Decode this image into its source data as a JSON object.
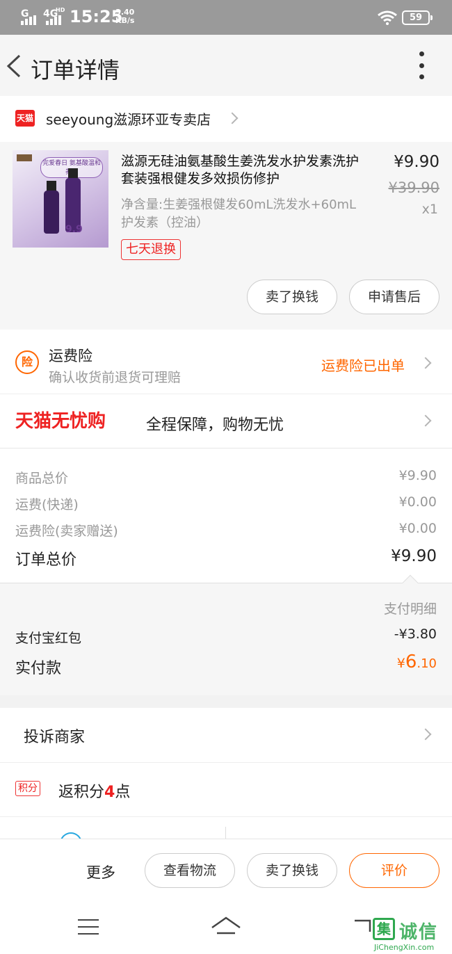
{
  "status_bar": {
    "network1": "G",
    "network2": "4G",
    "network2_sup": "HD",
    "time": "15:25",
    "speed_value": "3.40",
    "speed_unit": "KB/s",
    "battery": "59"
  },
  "header": {
    "title": "订单详情"
  },
  "shop": {
    "badge": "天猫",
    "name": "seeyoung滋源环亚专卖店"
  },
  "product": {
    "image_banner": "完爱春日 氨基酸温和养护",
    "image_promo": "9.9",
    "title": "滋源无硅油氨基酸生姜洗发水护发素洗护套装强根健发多效损伤修护",
    "price": "¥9.90",
    "original_price": "¥39.90",
    "quantity": "x1",
    "spec": "净含量:生姜强根健发60mL洗发水+60mL护发素（控油）",
    "tag": "七天退换",
    "sell_button": "卖了换钱",
    "aftersale_button": "申请售后"
  },
  "shipping_insurance": {
    "icon_text": "险",
    "title": "运费险",
    "subtitle": "确认收货前退货可理赔",
    "status": "运费险已出单"
  },
  "worry_free": {
    "logo": "天猫无忧购",
    "description": "全程保障，购物无忧"
  },
  "totals": {
    "items": [
      {
        "label": "商品总价",
        "value": "¥9.90"
      },
      {
        "label": "运费(快递)",
        "value": "¥0.00"
      },
      {
        "label": "运费险(卖家赠送)",
        "value": "¥0.00"
      }
    ],
    "order_total_label": "订单总价",
    "order_total_value": "¥9.90"
  },
  "payment": {
    "detail_label": "支付明细",
    "redpacket_label": "支付宝红包",
    "redpacket_value": "-¥3.80",
    "paid_label": "实付款",
    "paid_currency": "¥",
    "paid_integer": "6",
    "paid_decimal": ".10"
  },
  "complain": {
    "label": "投诉商家"
  },
  "points": {
    "badge": "积分",
    "prefix": "返积分",
    "count": "4",
    "suffix": "点"
  },
  "action_bar": {
    "more": "更多",
    "logistics": "查看物流",
    "sell": "卖了换钱",
    "rate": "评价"
  },
  "watermark": {
    "box": "集",
    "text": "诚信",
    "url": "JiChengXin.com"
  },
  "colors": {
    "accent_orange": "#ff6600",
    "tmall_red": "#e22222",
    "status_bar_gray": "#9a9a9a"
  }
}
